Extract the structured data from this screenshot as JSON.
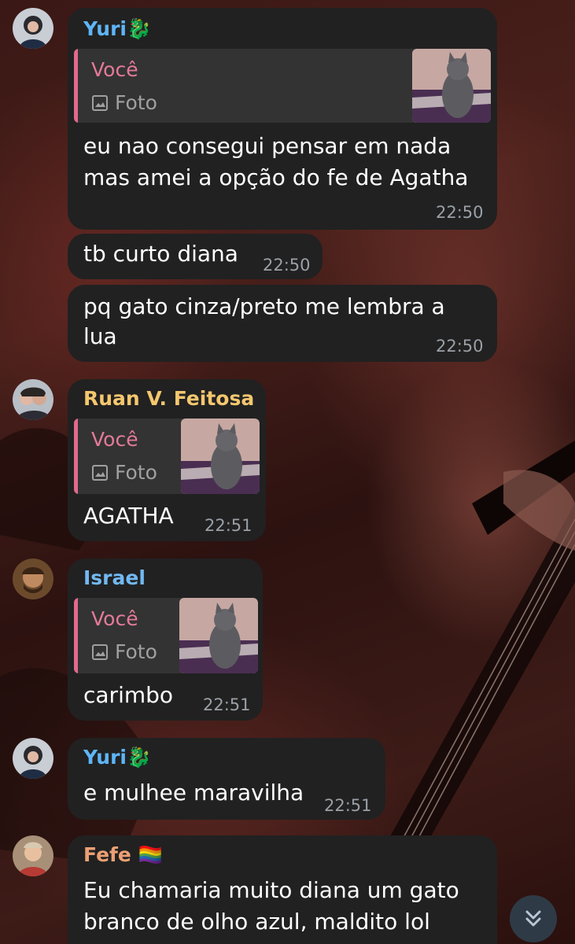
{
  "messages": [
    {
      "sender": "Yuri🐉",
      "reply": {
        "name": "Você",
        "kind": "Foto"
      },
      "lines": [
        "eu nao consegui pensar em nada",
        "mas amei a opção do fe de Agatha"
      ],
      "time": "22:50"
    },
    {
      "lines": [
        "tb curto diana"
      ],
      "time": "22:50"
    },
    {
      "lines": [
        "pq gato cinza/preto me lembra a",
        "lua"
      ],
      "time": "22:50"
    },
    {
      "sender": "Ruan V. Feitosa",
      "reply": {
        "name": "Você",
        "kind": "Foto"
      },
      "lines": [
        "AGATHA"
      ],
      "time": "22:51"
    },
    {
      "sender": "Israel",
      "reply": {
        "name": "Você",
        "kind": "Foto"
      },
      "lines": [
        "carimbo"
      ],
      "time": "22:51"
    },
    {
      "sender": "Yuri🐉",
      "lines": [
        "e mulhee maravilha"
      ],
      "time": "22:51"
    },
    {
      "sender": "Fefe 🏳️‍🌈",
      "lines": [
        "Eu chamaria muito diana um gato",
        "branco de olho azul, maldito lol"
      ]
    }
  ],
  "colors": {
    "bubble": "#212121",
    "name_yuri": "#5eb5f7",
    "name_ruan": "#f4c76f",
    "name_israel": "#72b8f2",
    "name_fefe": "#ec9f74",
    "reply_accent": "#e06a8c",
    "time": "#9aa0a6"
  },
  "icons": {
    "reply_media": "image-icon",
    "scroll": "chevron-double-down-icon"
  }
}
